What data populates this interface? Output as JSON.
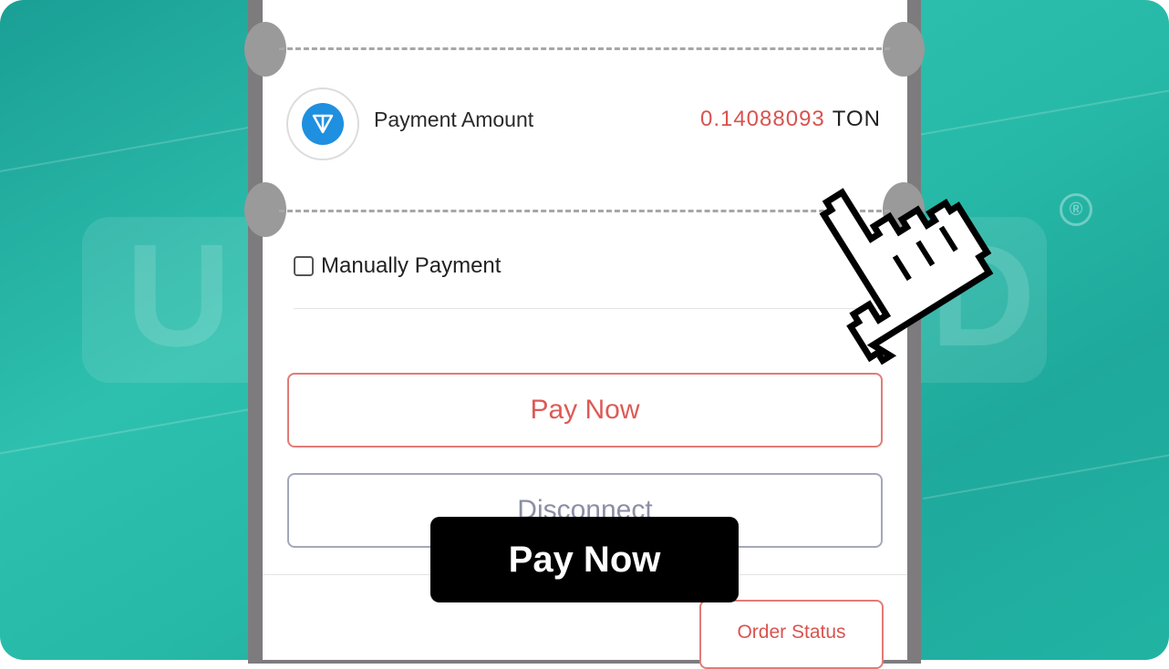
{
  "payment": {
    "label": "Payment Amount",
    "amount": "0.14088093",
    "currency": "TON",
    "token_icon": "ton-icon"
  },
  "manual": {
    "label": "Manually Payment",
    "checked": false
  },
  "buttons": {
    "pay_now": "Pay Now",
    "disconnect": "Disconnect",
    "order_status": "Order Status"
  },
  "caption": {
    "text": "Pay Now"
  },
  "watermark": {
    "registered_mark": "®"
  },
  "colors": {
    "accent_red": "#d9534f",
    "ton_blue": "#1f8fe0",
    "background_teal": "#27b9a7"
  },
  "cursor": {
    "icon": "pixel-hand-pointer-icon"
  }
}
